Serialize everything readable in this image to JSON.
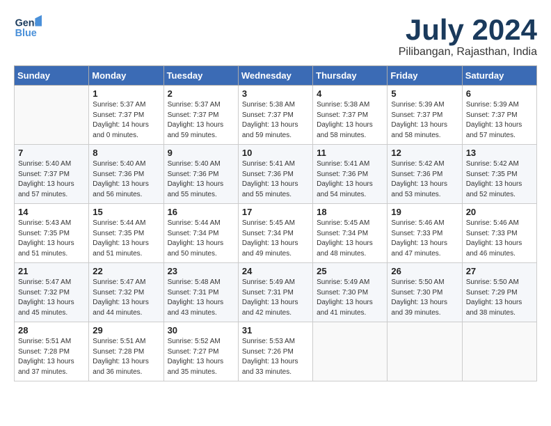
{
  "header": {
    "logo_line1": "General",
    "logo_line2": "Blue",
    "month": "July 2024",
    "location": "Pilibangan, Rajasthan, India"
  },
  "columns": [
    "Sunday",
    "Monday",
    "Tuesday",
    "Wednesday",
    "Thursday",
    "Friday",
    "Saturday"
  ],
  "weeks": [
    [
      {
        "day": "",
        "info": ""
      },
      {
        "day": "1",
        "info": "Sunrise: 5:37 AM\nSunset: 7:37 PM\nDaylight: 14 hours\nand 0 minutes."
      },
      {
        "day": "2",
        "info": "Sunrise: 5:37 AM\nSunset: 7:37 PM\nDaylight: 13 hours\nand 59 minutes."
      },
      {
        "day": "3",
        "info": "Sunrise: 5:38 AM\nSunset: 7:37 PM\nDaylight: 13 hours\nand 59 minutes."
      },
      {
        "day": "4",
        "info": "Sunrise: 5:38 AM\nSunset: 7:37 PM\nDaylight: 13 hours\nand 58 minutes."
      },
      {
        "day": "5",
        "info": "Sunrise: 5:39 AM\nSunset: 7:37 PM\nDaylight: 13 hours\nand 58 minutes."
      },
      {
        "day": "6",
        "info": "Sunrise: 5:39 AM\nSunset: 7:37 PM\nDaylight: 13 hours\nand 57 minutes."
      }
    ],
    [
      {
        "day": "7",
        "info": "Sunrise: 5:40 AM\nSunset: 7:37 PM\nDaylight: 13 hours\nand 57 minutes."
      },
      {
        "day": "8",
        "info": "Sunrise: 5:40 AM\nSunset: 7:36 PM\nDaylight: 13 hours\nand 56 minutes."
      },
      {
        "day": "9",
        "info": "Sunrise: 5:40 AM\nSunset: 7:36 PM\nDaylight: 13 hours\nand 55 minutes."
      },
      {
        "day": "10",
        "info": "Sunrise: 5:41 AM\nSunset: 7:36 PM\nDaylight: 13 hours\nand 55 minutes."
      },
      {
        "day": "11",
        "info": "Sunrise: 5:41 AM\nSunset: 7:36 PM\nDaylight: 13 hours\nand 54 minutes."
      },
      {
        "day": "12",
        "info": "Sunrise: 5:42 AM\nSunset: 7:36 PM\nDaylight: 13 hours\nand 53 minutes."
      },
      {
        "day": "13",
        "info": "Sunrise: 5:42 AM\nSunset: 7:35 PM\nDaylight: 13 hours\nand 52 minutes."
      }
    ],
    [
      {
        "day": "14",
        "info": "Sunrise: 5:43 AM\nSunset: 7:35 PM\nDaylight: 13 hours\nand 51 minutes."
      },
      {
        "day": "15",
        "info": "Sunrise: 5:44 AM\nSunset: 7:35 PM\nDaylight: 13 hours\nand 51 minutes."
      },
      {
        "day": "16",
        "info": "Sunrise: 5:44 AM\nSunset: 7:34 PM\nDaylight: 13 hours\nand 50 minutes."
      },
      {
        "day": "17",
        "info": "Sunrise: 5:45 AM\nSunset: 7:34 PM\nDaylight: 13 hours\nand 49 minutes."
      },
      {
        "day": "18",
        "info": "Sunrise: 5:45 AM\nSunset: 7:34 PM\nDaylight: 13 hours\nand 48 minutes."
      },
      {
        "day": "19",
        "info": "Sunrise: 5:46 AM\nSunset: 7:33 PM\nDaylight: 13 hours\nand 47 minutes."
      },
      {
        "day": "20",
        "info": "Sunrise: 5:46 AM\nSunset: 7:33 PM\nDaylight: 13 hours\nand 46 minutes."
      }
    ],
    [
      {
        "day": "21",
        "info": "Sunrise: 5:47 AM\nSunset: 7:32 PM\nDaylight: 13 hours\nand 45 minutes."
      },
      {
        "day": "22",
        "info": "Sunrise: 5:47 AM\nSunset: 7:32 PM\nDaylight: 13 hours\nand 44 minutes."
      },
      {
        "day": "23",
        "info": "Sunrise: 5:48 AM\nSunset: 7:31 PM\nDaylight: 13 hours\nand 43 minutes."
      },
      {
        "day": "24",
        "info": "Sunrise: 5:49 AM\nSunset: 7:31 PM\nDaylight: 13 hours\nand 42 minutes."
      },
      {
        "day": "25",
        "info": "Sunrise: 5:49 AM\nSunset: 7:30 PM\nDaylight: 13 hours\nand 41 minutes."
      },
      {
        "day": "26",
        "info": "Sunrise: 5:50 AM\nSunset: 7:30 PM\nDaylight: 13 hours\nand 39 minutes."
      },
      {
        "day": "27",
        "info": "Sunrise: 5:50 AM\nSunset: 7:29 PM\nDaylight: 13 hours\nand 38 minutes."
      }
    ],
    [
      {
        "day": "28",
        "info": "Sunrise: 5:51 AM\nSunset: 7:28 PM\nDaylight: 13 hours\nand 37 minutes."
      },
      {
        "day": "29",
        "info": "Sunrise: 5:51 AM\nSunset: 7:28 PM\nDaylight: 13 hours\nand 36 minutes."
      },
      {
        "day": "30",
        "info": "Sunrise: 5:52 AM\nSunset: 7:27 PM\nDaylight: 13 hours\nand 35 minutes."
      },
      {
        "day": "31",
        "info": "Sunrise: 5:53 AM\nSunset: 7:26 PM\nDaylight: 13 hours\nand 33 minutes."
      },
      {
        "day": "",
        "info": ""
      },
      {
        "day": "",
        "info": ""
      },
      {
        "day": "",
        "info": ""
      }
    ]
  ]
}
